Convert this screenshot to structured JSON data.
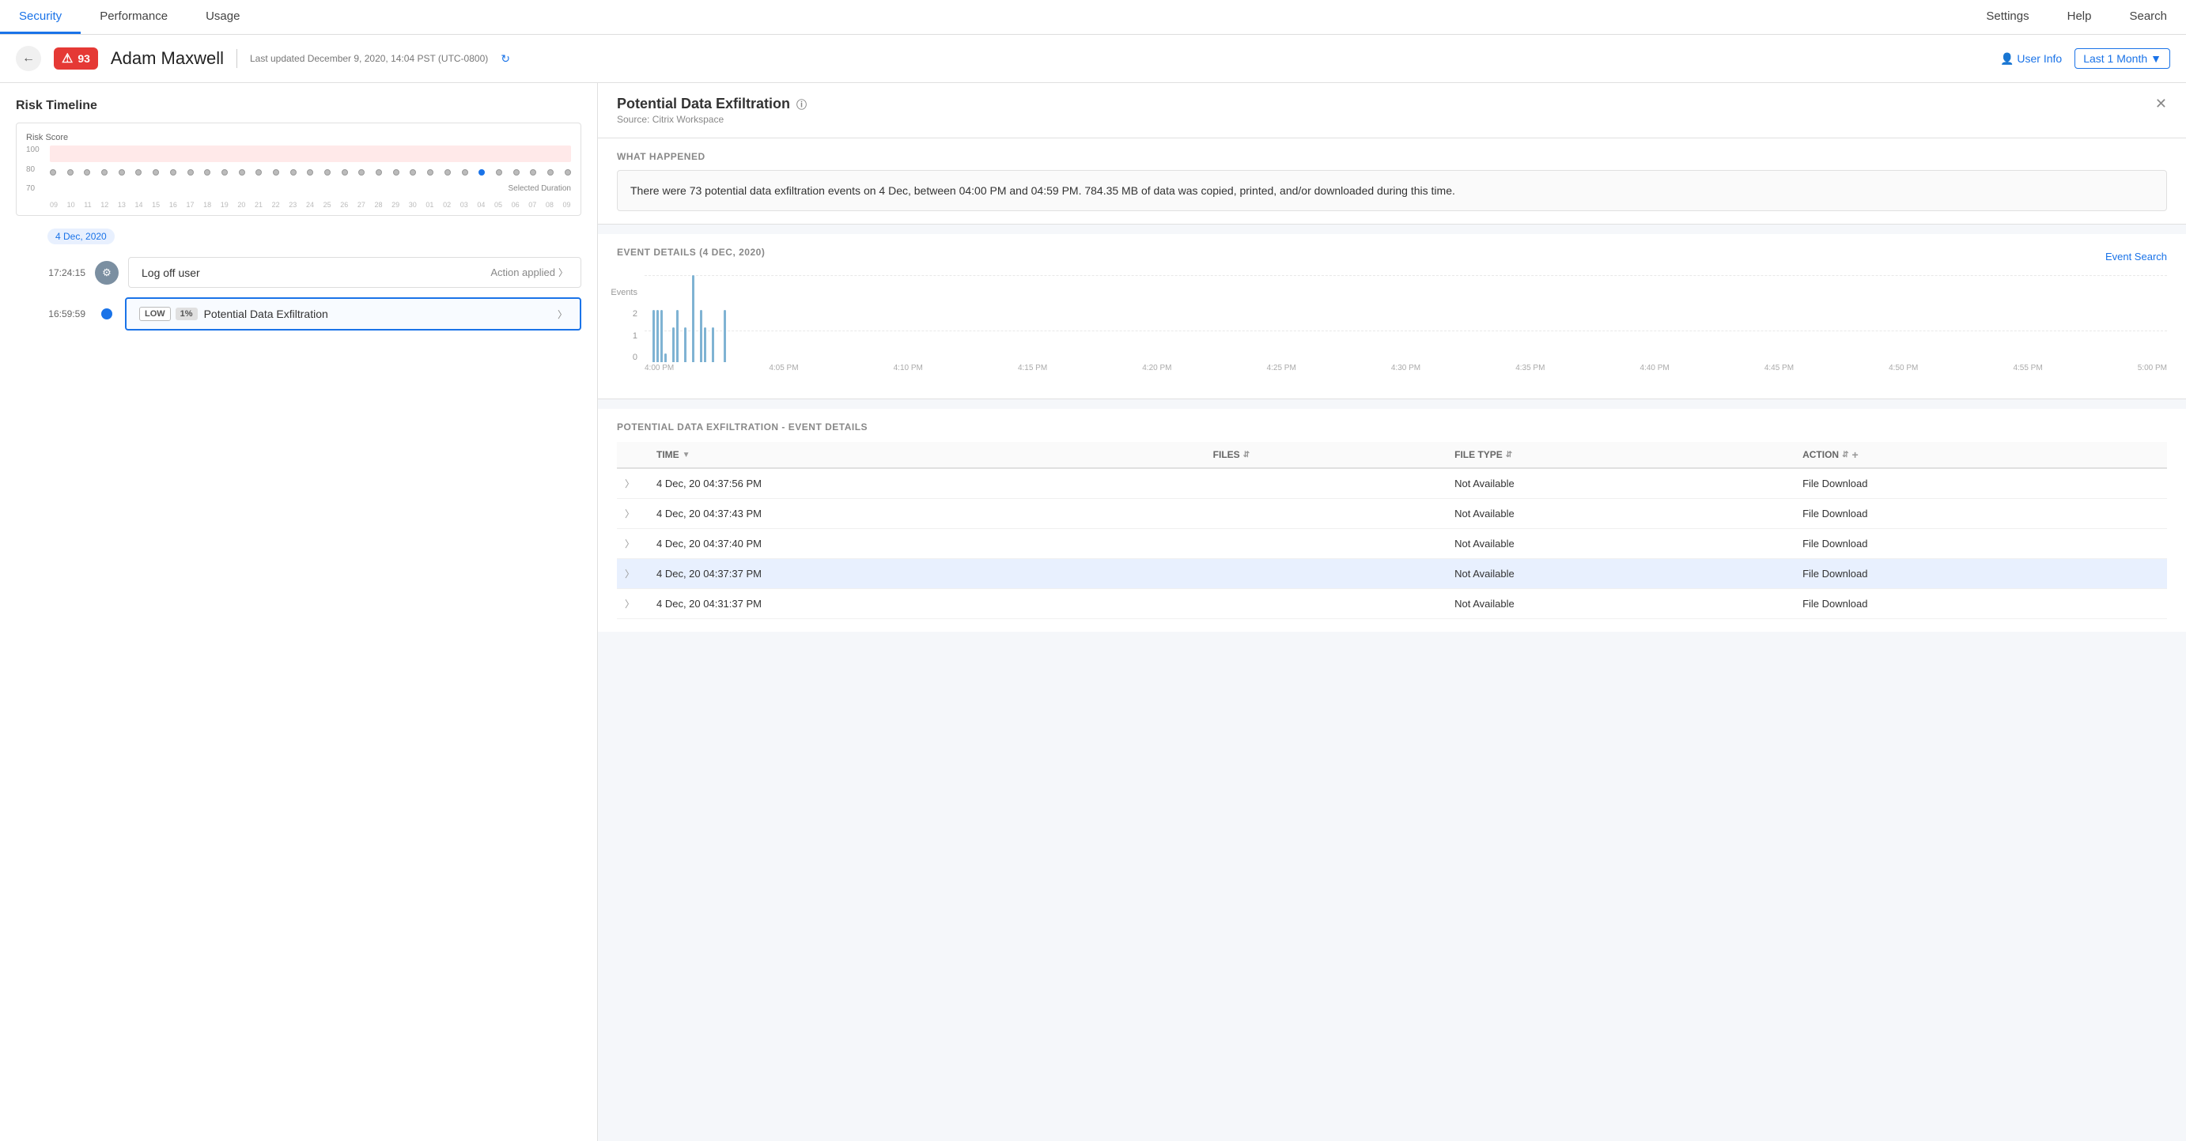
{
  "nav": {
    "items": [
      "Security",
      "Performance",
      "Usage"
    ],
    "right_items": [
      "Settings",
      "Help",
      "Search"
    ],
    "active": "Security"
  },
  "subheader": {
    "user_name": "Adam Maxwell",
    "risk_score": "93",
    "last_updated": "Last updated December 9, 2020, 14:04 PST (UTC-0800)",
    "user_info_label": "User Info",
    "time_filter": "Last 1 Month"
  },
  "left": {
    "section_title": "Risk Timeline",
    "chart": {
      "y_label": "Risk Score",
      "y_values": [
        "100",
        "80",
        "70"
      ],
      "x_values": [
        "09",
        "10",
        "11",
        "12",
        "13",
        "14",
        "15",
        "16",
        "17",
        "18",
        "19",
        "20",
        "21",
        "22",
        "23",
        "24",
        "25",
        "26",
        "27",
        "28",
        "29",
        "30",
        "01",
        "02",
        "03",
        "04",
        "05",
        "06",
        "07",
        "08",
        "09"
      ],
      "selected_label": "Selected Duration"
    },
    "date_bubble": "4 Dec, 2020",
    "events": [
      {
        "time": "17:24:15",
        "icon_type": "gear",
        "name": "Log off user",
        "action": "Action applied",
        "type": "action",
        "selected": false
      },
      {
        "time": "16:59:59",
        "icon_type": "dot",
        "badge_severity": "LOW",
        "badge_count": "1%",
        "name": "Potential Data Exfiltration",
        "type": "event",
        "selected": true
      }
    ]
  },
  "right": {
    "detail_title": "Potential Data Exfiltration",
    "detail_source": "Source: Citrix Workspace",
    "what_happened_label": "WHAT HAPPENED",
    "what_happened_text": "There were 73 potential data exfiltration events on 4 Dec, between 04:00 PM and 04:59 PM. 784.35 MB of data was copied, printed, and/or downloaded during this time.",
    "event_details_label": "EVENT DETAILS (4 DEC, 2020)",
    "event_search_label": "Event Search",
    "chart": {
      "y_labels": [
        "2",
        "1",
        "0"
      ],
      "x_labels": [
        "4:00 PM",
        "4:05 PM",
        "4:10 PM",
        "4:15 PM",
        "4:20 PM",
        "4:25 PM",
        "4:30 PM",
        "4:35 PM",
        "4:40 PM",
        "4:45 PM",
        "4:50 PM",
        "4:55 PM",
        "5:00 PM"
      ],
      "bars": [
        {
          "x": 0,
          "height_pct": 0
        },
        {
          "x": 1,
          "height_pct": 0
        },
        {
          "x": 2,
          "height_pct": 60
        },
        {
          "x": 3,
          "height_pct": 60
        },
        {
          "x": 4,
          "height_pct": 60
        },
        {
          "x": 5,
          "height_pct": 10
        },
        {
          "x": 6,
          "height_pct": 0
        },
        {
          "x": 7,
          "height_pct": 40
        },
        {
          "x": 8,
          "height_pct": 60
        },
        {
          "x": 9,
          "height_pct": 0
        },
        {
          "x": 10,
          "height_pct": 40
        },
        {
          "x": 11,
          "height_pct": 0
        },
        {
          "x": 12,
          "height_pct": 100
        },
        {
          "x": 13,
          "height_pct": 0
        },
        {
          "x": 14,
          "height_pct": 60
        },
        {
          "x": 15,
          "height_pct": 40
        },
        {
          "x": 16,
          "height_pct": 0
        },
        {
          "x": 17,
          "height_pct": 40
        },
        {
          "x": 18,
          "height_pct": 0
        },
        {
          "x": 19,
          "height_pct": 0
        },
        {
          "x": 20,
          "height_pct": 60
        },
        {
          "x": 21,
          "height_pct": 0
        },
        {
          "x": 22,
          "height_pct": 0
        },
        {
          "x": 23,
          "height_pct": 0
        },
        {
          "x": 24,
          "height_pct": 0
        }
      ],
      "yaxis_label": "Events"
    },
    "exfil_title": "POTENTIAL DATA EXFILTRATION - EVENT DETAILS",
    "table": {
      "columns": [
        "TIME",
        "FILES",
        "FILE TYPE",
        "ACTION"
      ],
      "rows": [
        {
          "time": "4 Dec, 20 04:37:56 PM",
          "files": "",
          "file_type": "Not Available",
          "action": "File Download",
          "highlighted": false
        },
        {
          "time": "4 Dec, 20 04:37:43 PM",
          "files": "",
          "file_type": "Not Available",
          "action": "File Download",
          "highlighted": false
        },
        {
          "time": "4 Dec, 20 04:37:40 PM",
          "files": "",
          "file_type": "Not Available",
          "action": "File Download",
          "highlighted": false
        },
        {
          "time": "4 Dec, 20 04:37:37 PM",
          "files": "",
          "file_type": "Not Available",
          "action": "File Download",
          "highlighted": true
        },
        {
          "time": "4 Dec, 20 04:31:37 PM",
          "files": "",
          "file_type": "Not Available",
          "action": "File Download",
          "highlighted": false
        }
      ]
    }
  }
}
